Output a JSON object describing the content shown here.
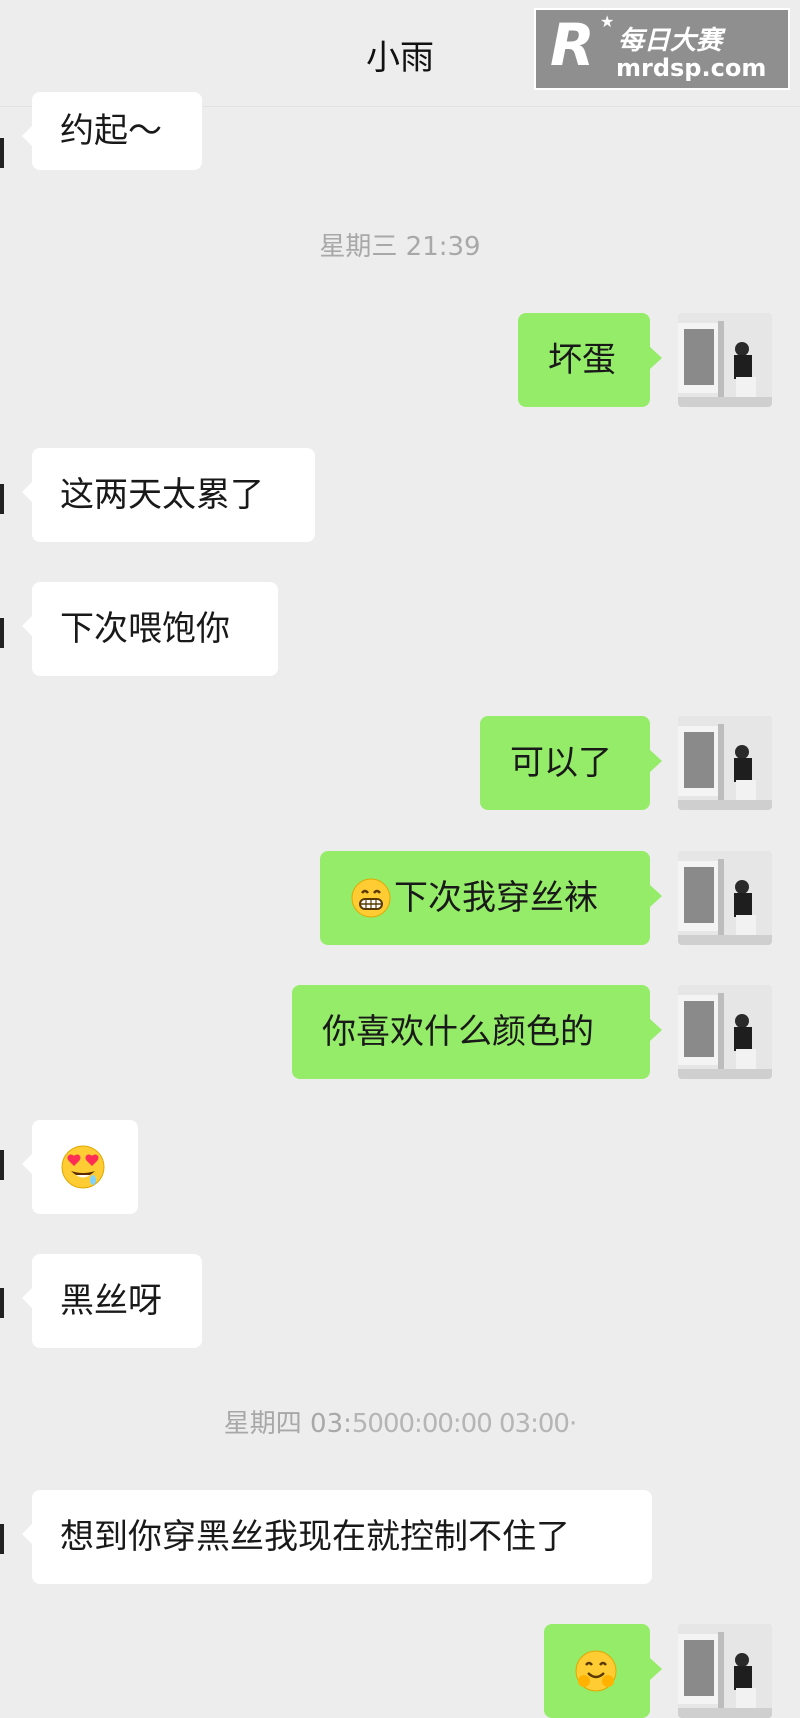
{
  "header": {
    "title": "小雨"
  },
  "watermark": {
    "logo_letter": "R",
    "star": "★",
    "name": "每日大赛",
    "url": "mrdsp.com"
  },
  "messages": [
    {
      "side": "in",
      "text": "约起～"
    },
    {
      "type": "timestamp",
      "text": "星期三 21:39"
    },
    {
      "side": "out",
      "text": "坏蛋"
    },
    {
      "side": "in",
      "text": "这两天太累了"
    },
    {
      "side": "in",
      "text": "下次喂饱你"
    },
    {
      "side": "out",
      "text": "可以了"
    },
    {
      "side": "out",
      "emoji": "grinning-face",
      "text": "下次我穿丝袜"
    },
    {
      "side": "out",
      "text": "你喜欢什么颜色的"
    },
    {
      "side": "in",
      "emoji": "heart-eyes-drooling-face",
      "text": ""
    },
    {
      "side": "in",
      "text": "黑丝呀"
    },
    {
      "type": "timestamp",
      "text": "星期四 03:",
      "garbled_tail": "5000:00:00 03:00·"
    },
    {
      "side": "in",
      "text": "想到你穿黑丝我现在就控制不住了"
    },
    {
      "side": "out",
      "emoji": "hugging-face",
      "text": ""
    }
  ],
  "colors": {
    "background": "#ededed",
    "incoming_bubble": "#ffffff",
    "outgoing_bubble": "#95ec69",
    "timestamp": "#a8a8a8"
  }
}
